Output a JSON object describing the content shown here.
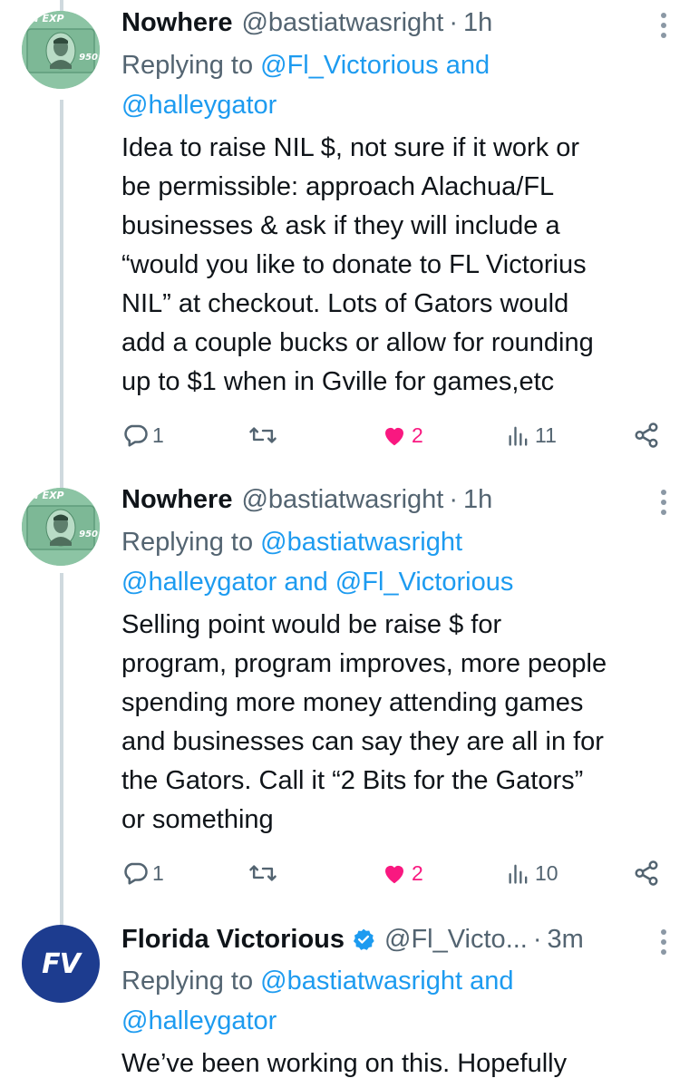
{
  "tweets": [
    {
      "author": {
        "name": "Nowhere",
        "handle": "@bastiatwasright",
        "time": "1h",
        "avatar": "currency-portrait-avatar",
        "avatar_text_top": "EN EXP",
        "avatar_text_side": "950"
      },
      "replying": {
        "prefix": "Replying to ",
        "line1_link": "@Fl_Victorious and",
        "line2_link": "@halleygator"
      },
      "body": [
        "Idea to raise NIL $, not sure if it work or",
        "be permissible: approach Alachua/FL",
        "businesses & ask if they will include a",
        "“would you like to donate to FL Victorius",
        "NIL” at checkout. Lots of Gators would",
        "add a couple bucks or allow for rounding",
        "up to $1 when in Gville for games,etc"
      ],
      "stats": {
        "replies": "1",
        "likes": "2",
        "views": "11"
      }
    },
    {
      "author": {
        "name": "Nowhere",
        "handle": "@bastiatwasright",
        "time": "1h",
        "avatar": "currency-portrait-avatar",
        "avatar_text_top": "EN EXP",
        "avatar_text_side": "950"
      },
      "replying": {
        "prefix": "Replying to ",
        "line1_link": "@bastiatwasright",
        "line2_link": "@halleygator and @Fl_Victorious"
      },
      "body": [
        "Selling point would be raise $ for",
        "program, program improves, more people",
        "spending more money attending games",
        "and businesses can say they are all in for",
        "the Gators. Call it “2 Bits for the Gators”",
        "or something"
      ],
      "stats": {
        "replies": "1",
        "likes": "2",
        "views": "10"
      }
    },
    {
      "author": {
        "name": "Florida Victorious",
        "handle": "@Fl_Victo...",
        "time": "3m",
        "avatar_text": "FV",
        "verified": true
      },
      "replying": {
        "prefix": "Replying to ",
        "line1_link": "@bastiatwasright and",
        "line2_link": "@halleygator"
      },
      "body": [
        "We’ve been working on this. Hopefully"
      ]
    }
  ],
  "colors": {
    "accent": "#1d9bf0",
    "like": "#f91880",
    "muted": "#536471",
    "thread_line": "#cfd9de"
  },
  "icons": [
    "more-icon",
    "reply-icon",
    "retweet-icon",
    "like-icon",
    "views-icon",
    "share-icon",
    "verified-icon"
  ]
}
